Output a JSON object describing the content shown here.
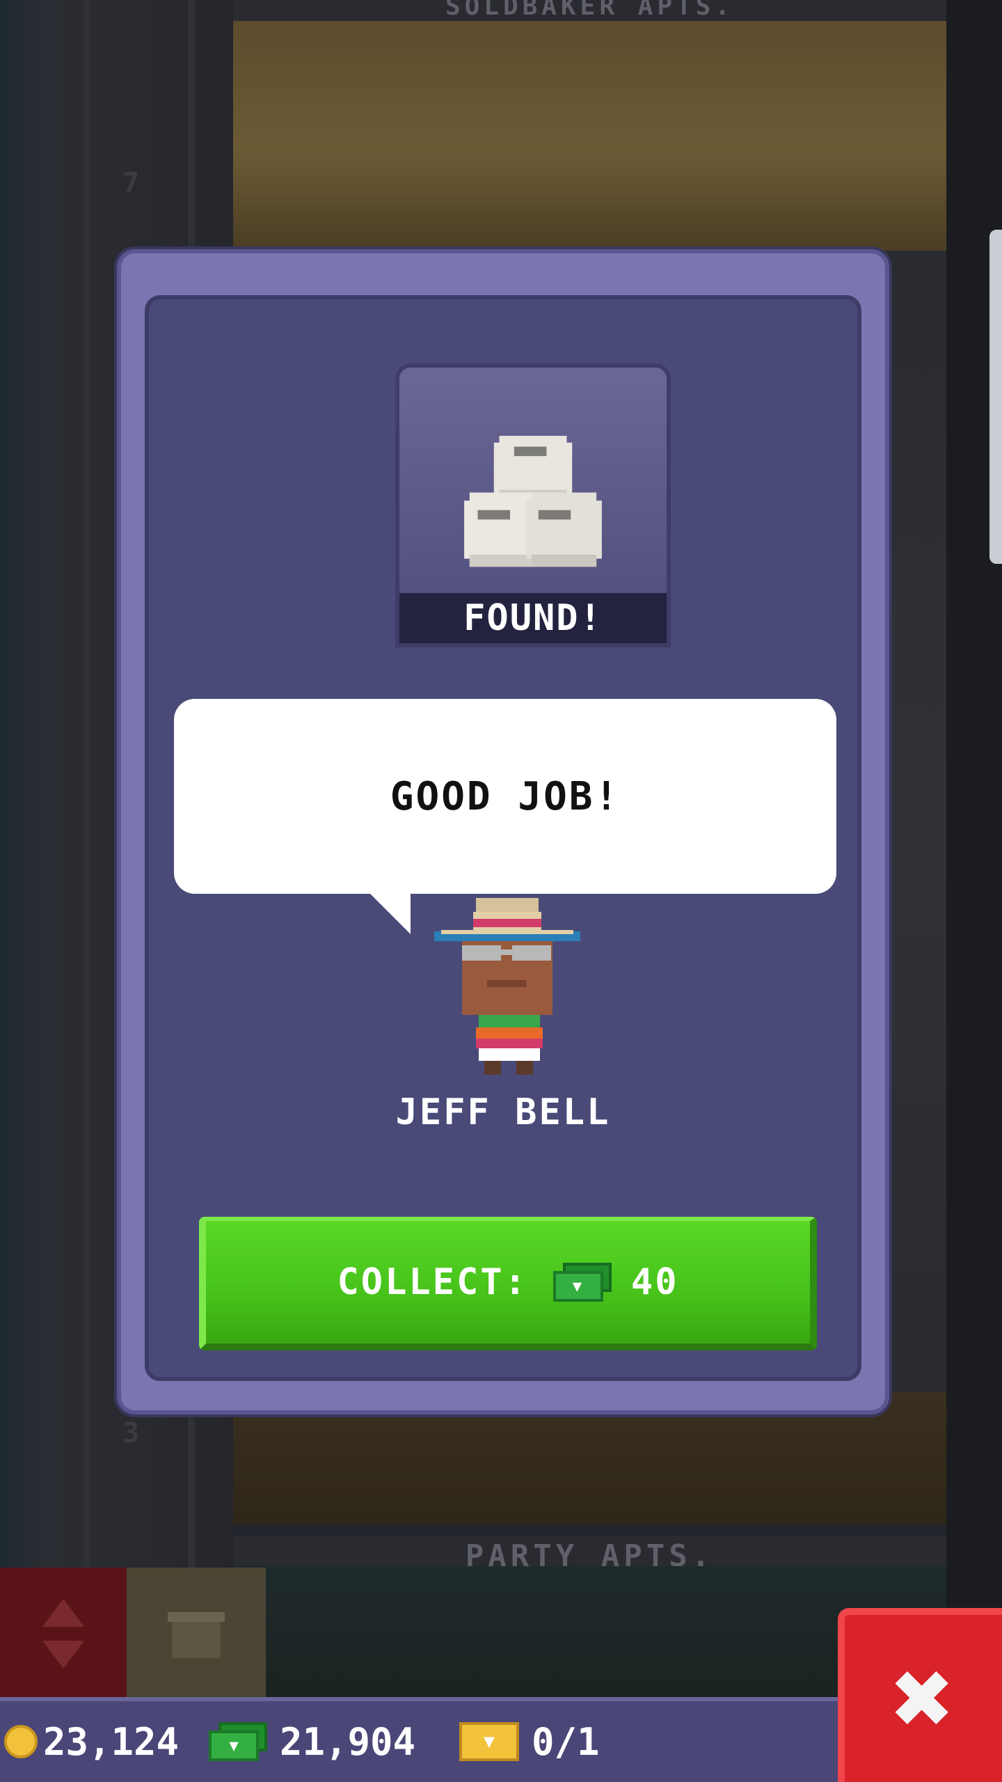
{
  "background": {
    "floor_top_label": "SOLDBAKER APTS.",
    "floor_bottom_label": "PARTY APTS.",
    "floor_numbers": [
      "7",
      "3"
    ]
  },
  "modal": {
    "item_status": "FOUND!",
    "item_icon": "toilet-paper-rolls-icon",
    "speech_text": "GOOD JOB!",
    "character_name": "JEFF BELL",
    "collect_label": "COLLECT:",
    "collect_amount": "40",
    "collect_currency_icon": "tower-bux-icon"
  },
  "status_bar": {
    "coins": "23,124",
    "bux": "21,904",
    "tickets": "0/1"
  },
  "colors": {
    "modal_frame": "#7b76b2",
    "modal_inner": "#4a4a78",
    "collect_green": "#46c21a",
    "close_red": "#d9222a",
    "status_bar": "#4a4677"
  }
}
